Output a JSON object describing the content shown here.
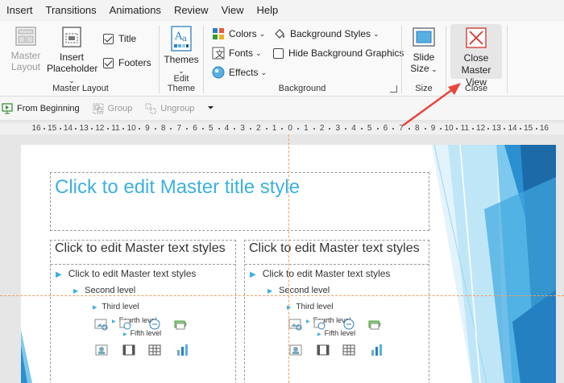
{
  "menu": [
    "Insert",
    "Transitions",
    "Animations",
    "Review",
    "View",
    "Help"
  ],
  "ribbon": {
    "master_layout": {
      "group_label": "Master Layout",
      "master_layout_btn": "Master Layout",
      "insert_placeholder_btn": [
        "Insert",
        "Placeholder"
      ],
      "title_check": "Title",
      "footers_check": "Footers"
    },
    "edit_theme": {
      "group_label": "Edit Theme",
      "themes_btn": "Themes"
    },
    "background": {
      "group_label": "Background",
      "colors": "Colors",
      "fonts": "Fonts",
      "effects": "Effects",
      "background_styles": "Background Styles",
      "hide_bg_graphics": "Hide Background Graphics"
    },
    "size": {
      "group_label": "Size",
      "slide_size_btn": [
        "Slide",
        "Size"
      ]
    },
    "close": {
      "group_label": "Close",
      "close_master_btn": [
        "Close",
        "Master View"
      ]
    }
  },
  "qat": {
    "from_beginning": "From Beginning",
    "group": "Group",
    "ungroup": "Ungroup"
  },
  "ruler_ticks": [
    "16",
    "15",
    "14",
    "13",
    "12",
    "11",
    "10",
    "9",
    "8",
    "7",
    "6",
    "5",
    "4",
    "3",
    "2",
    "1",
    "0",
    "1",
    "2",
    "3",
    "4",
    "5",
    "6",
    "7",
    "8",
    "9",
    "10",
    "11",
    "12",
    "13",
    "14",
    "15",
    "16"
  ],
  "slide": {
    "title": "Click to edit Master title style",
    "left_col_title": "Click to edit Master text styles",
    "right_col_title": "Click to edit Master text styles",
    "level1": "Click to edit Master text styles",
    "level2": "Second level",
    "level3": "Third level",
    "level4": "Fourth level",
    "level5": "Fifth level"
  },
  "colors": {
    "accent": "#3cb0e0",
    "annotation_arrow": "#e8463c"
  }
}
